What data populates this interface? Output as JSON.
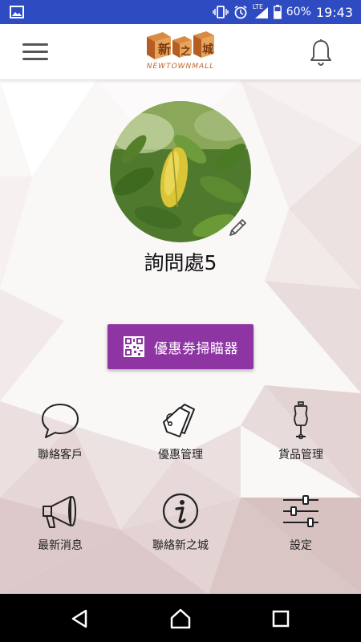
{
  "status_bar": {
    "battery": "60%",
    "time": "19:43",
    "network": "LTE"
  },
  "app_bar": {
    "logo_tagline": "NEWTOWNMALL",
    "logo_chars": [
      "新",
      "之",
      "城"
    ],
    "logo_color": "#c8702f"
  },
  "profile": {
    "username": "詢問處5"
  },
  "scanner_button": {
    "label": "優惠劵掃瞄器",
    "color": "#8e35a3"
  },
  "grid": {
    "contact_customers": "聯絡客戶",
    "coupon_management": "優惠管理",
    "goods_management": "貨品管理",
    "latest_news": "最新消息",
    "contact_newtown": "聯絡新之城",
    "settings": "設定"
  }
}
